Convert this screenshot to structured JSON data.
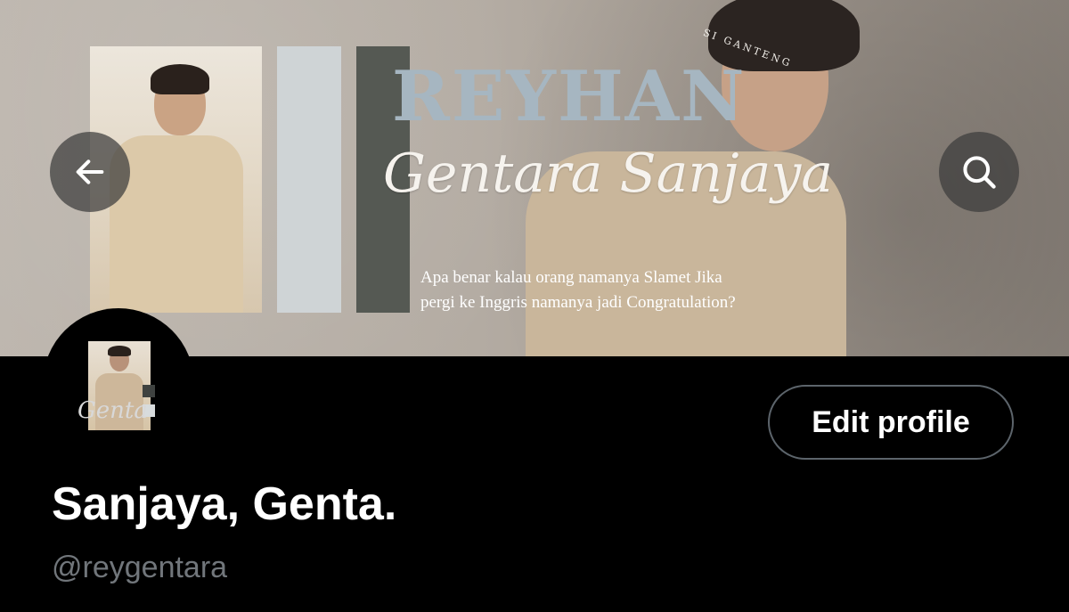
{
  "header": {
    "banner": {
      "title": "REYHAN",
      "tagline": "SI GANTENG",
      "script_name": "Gentara Sanjaya",
      "quote_line1": "Apa benar kalau orang namanya Slamet Jika",
      "quote_line2": "pergi ke Inggris namanya jadi Congratulation?"
    },
    "back_icon": "arrow-left-icon",
    "search_icon": "search-icon"
  },
  "profile": {
    "avatar_script": "Genta",
    "edit_button_label": "Edit profile",
    "display_name": "Sanjaya, Genta.",
    "handle": "@reygentara"
  },
  "colors": {
    "background": "#000000",
    "secondary_text": "#71767b",
    "button_border": "#5c646b",
    "banner_accent": "#a6b6c1"
  }
}
